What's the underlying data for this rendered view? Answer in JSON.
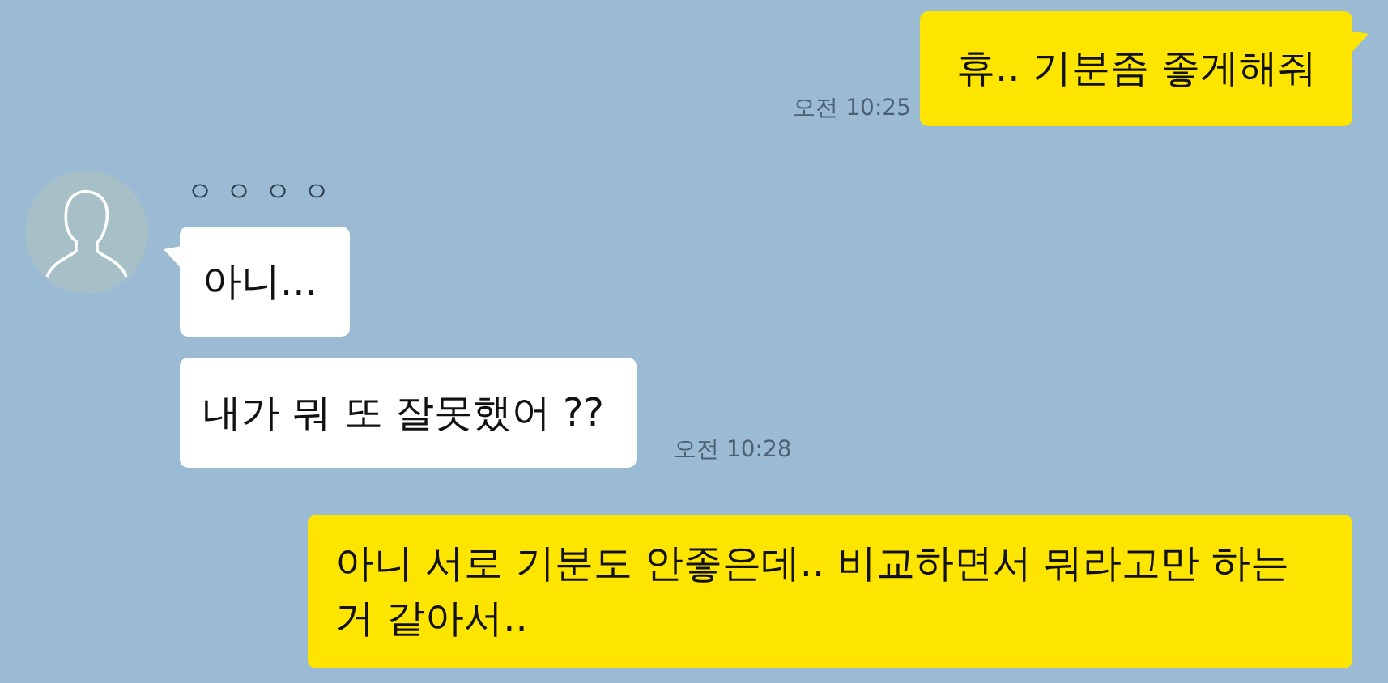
{
  "messages": [
    {
      "kind": "sent",
      "text": "휴.. 기분좀 좋게해줘",
      "time": "오전 10:25",
      "tail": true
    },
    {
      "kind": "received_group",
      "sender": "ㅇㅇㅇㅇ",
      "bubbles": [
        {
          "text": "아니...",
          "tail": true
        },
        {
          "text": "내가 뭐 또 잘못했어 ??",
          "tail": false,
          "time": "오전 10:28"
        }
      ]
    },
    {
      "kind": "sent",
      "text": "아니 서로 기분도 안좋은데.. 비교하면서 뭐라고만 하는거 같아서..",
      "tail": false
    }
  ]
}
